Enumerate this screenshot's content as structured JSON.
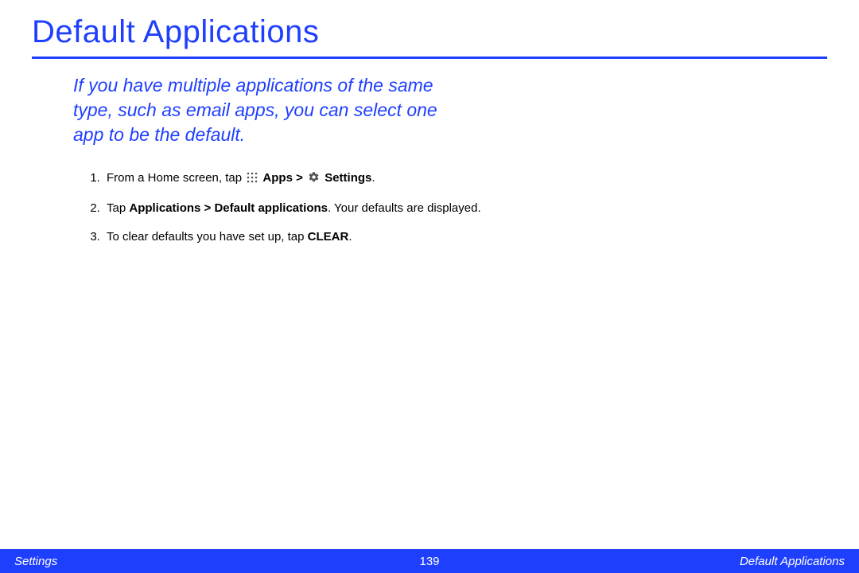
{
  "title": "Default Applications",
  "intro": "If you have multiple applications of the same type, such as email apps, you can select one app to be the default.",
  "steps": {
    "s1_prefix": "From a Home screen, tap ",
    "s1_apps": "Apps",
    "s1_gt": " > ",
    "s1_settings": "Settings",
    "s1_suffix": ".",
    "s2_prefix": "Tap ",
    "s2_bold": "Applications > Default applications",
    "s2_suffix": ". Your defaults are displayed.",
    "s3_prefix": "To clear defaults you have set up, tap ",
    "s3_bold": "CLEAR",
    "s3_suffix": "."
  },
  "footer": {
    "left": "Settings",
    "center": "139",
    "right": "Default Applications"
  }
}
